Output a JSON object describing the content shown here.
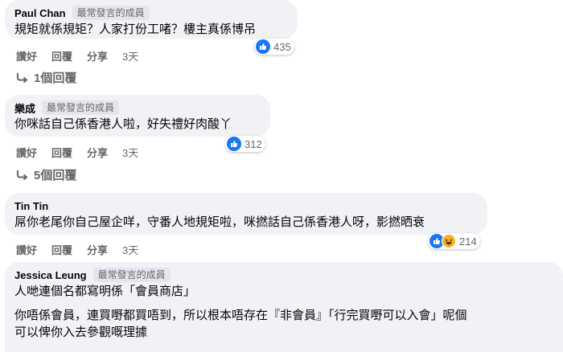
{
  "comments": [
    {
      "name": "Paul Chan",
      "badge": "最常發言的成員",
      "lines": [
        "規矩就係規矩？人家打份工啫？樓主真係博吊"
      ],
      "actions": {
        "like": "讚好",
        "reply": "回覆",
        "share": "分享",
        "time": "3天"
      },
      "reaction_count": "435",
      "reply_summary": "1個回覆"
    },
    {
      "name": "樂成",
      "badge": "最常發言的成員",
      "lines": [
        "你咪話自己係香港人啦，好失禮好肉酸丫"
      ],
      "actions": {
        "like": "讚好",
        "reply": "回覆",
        "share": "分享",
        "time": "3天"
      },
      "reaction_count": "312",
      "reply_summary": "5個回覆"
    },
    {
      "name": "Tin Tin",
      "badge": "",
      "lines": [
        "屌你老尾你自己屋企咩，守番人地規矩啦，咪撚話自己係香港人呀，影撚晒衰"
      ],
      "actions": {
        "like": "讚好",
        "reply": "回覆",
        "share": "分享",
        "time": "3天"
      },
      "reaction_count": "214"
    },
    {
      "name": "Jessica Leung",
      "badge": "最常發言的成員",
      "lines": [
        "人哋連個名都寫明係「會員商店」",
        "你唔係會員，連買嘢都買唔到，所以根本唔存在『非會員』「行完買嘢可以入會」呢個",
        "可以俾你入去參觀嘅理據"
      ]
    }
  ],
  "colors": {
    "bubble": "#f0f2f5",
    "like": "#1877f2",
    "muted": "#65676b"
  }
}
